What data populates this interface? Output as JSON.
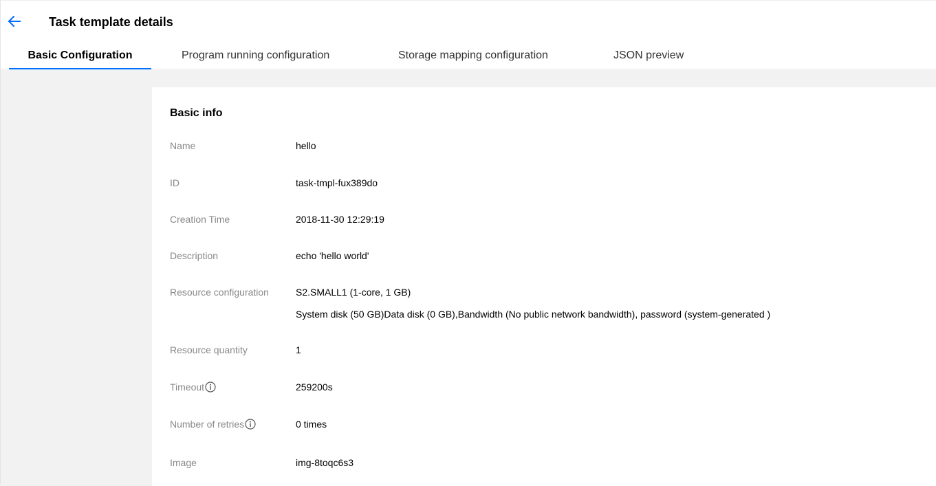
{
  "header": {
    "back_icon": "arrow-left-icon",
    "title": "Task template details"
  },
  "tabs": [
    {
      "label": "Basic Configuration",
      "active": true
    },
    {
      "label": "Program running configuration",
      "active": false
    },
    {
      "label": "Storage mapping configuration",
      "active": false
    },
    {
      "label": "JSON preview",
      "active": false
    }
  ],
  "basic_info": {
    "title": "Basic info",
    "rows": [
      {
        "label": "Name",
        "value": "hello"
      },
      {
        "label": "ID",
        "value": "task-tmpl-fux389do"
      },
      {
        "label": "Creation Time",
        "value": "2018-11-30 12:29:19"
      },
      {
        "label": "Description",
        "value": "echo 'hello world'"
      },
      {
        "label": "Resource configuration",
        "value": "S2.SMALL1 (1-core, 1 GB)",
        "value_line2": "System disk (50 GB)Data disk (0 GB),Bandwidth (No public network bandwidth), password (system-generated )"
      },
      {
        "label": "Resource quantity",
        "value": "1"
      },
      {
        "label": "Timeout",
        "value": "259200s",
        "icon": "info-icon"
      },
      {
        "label": "Number of retries",
        "value": "0 times",
        "icon": "info-icon"
      },
      {
        "label": "Image",
        "value": "img-8toqc6s3"
      }
    ]
  },
  "colors": {
    "accent": "#006eff",
    "label": "#888888",
    "background": "#f2f2f2"
  }
}
